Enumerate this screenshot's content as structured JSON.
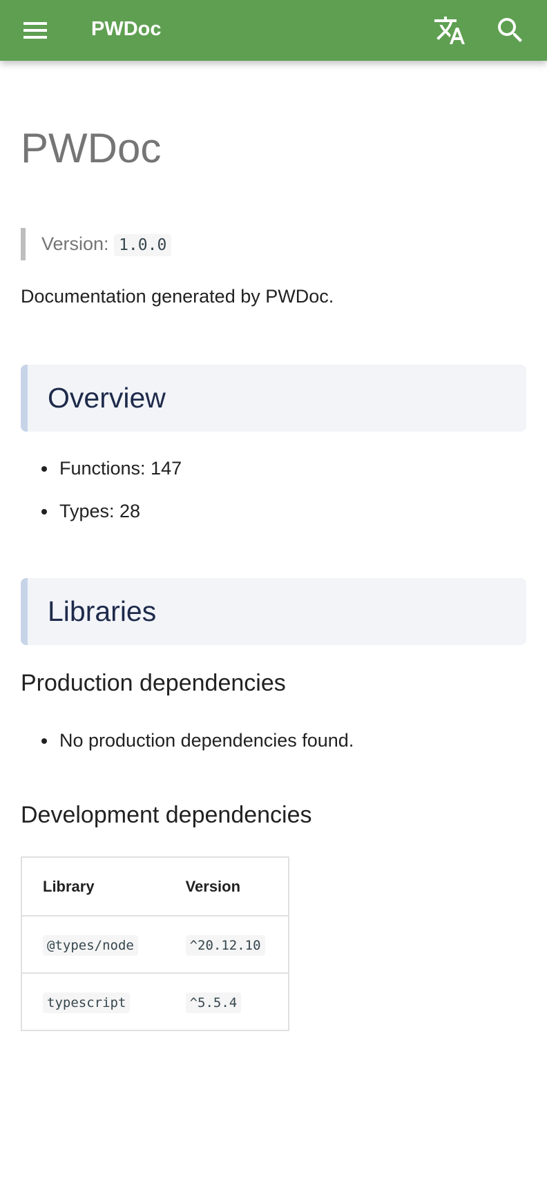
{
  "header": {
    "title": "PWDoc",
    "menu_icon": "menu-icon",
    "translate_icon": "translate-icon",
    "search_icon": "search-icon",
    "color": "#5f9f52"
  },
  "page": {
    "title": "PWDoc",
    "version_label": "Version:",
    "version": "1.0.0",
    "description": "Documentation generated by PWDoc."
  },
  "overview": {
    "title": "Overview",
    "items": [
      "Functions: 147",
      "Types: 28"
    ]
  },
  "libraries": {
    "title": "Libraries",
    "production_title": "Production dependencies",
    "production_items": [
      "No production dependencies found."
    ],
    "development_title": "Development dependencies",
    "table": {
      "headers": [
        "Library",
        "Version"
      ],
      "rows": [
        [
          "@types/node",
          "^20.12.10"
        ],
        [
          "typescript",
          "^5.5.4"
        ]
      ]
    }
  }
}
